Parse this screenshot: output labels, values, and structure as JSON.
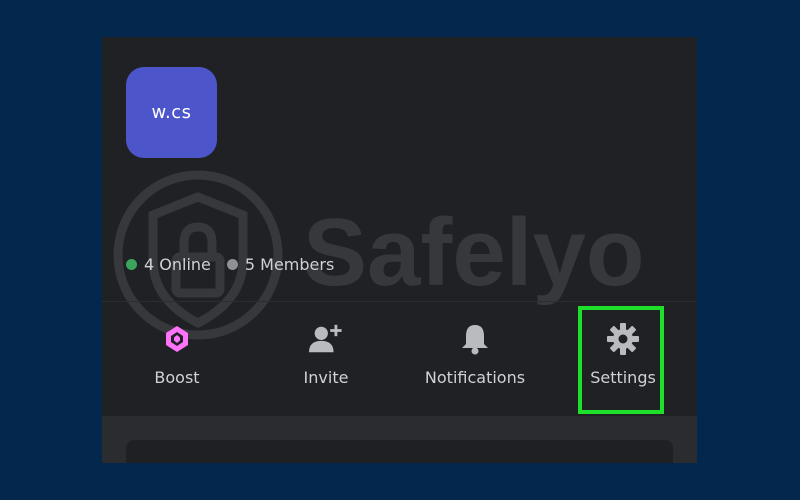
{
  "server": {
    "icon_label": "w.cs",
    "icon_color": "#4c55c9"
  },
  "stats": {
    "online": "4 Online",
    "members": "5 Members",
    "online_color": "#3ba55d",
    "members_color": "#8e9297"
  },
  "actions": [
    {
      "label": "Boost",
      "icon": "boost-gem-icon",
      "color": "#ff73fa"
    },
    {
      "label": "Invite",
      "icon": "add-user-icon",
      "color": "#b9bbbe"
    },
    {
      "label": "Notifications",
      "icon": "bell-icon",
      "color": "#b9bbbe"
    },
    {
      "label": "Settings",
      "icon": "gear-icon",
      "color": "#b9bbbe"
    }
  ],
  "highlight_color": "#1ee02a",
  "watermark": {
    "text": "Safelyo"
  }
}
